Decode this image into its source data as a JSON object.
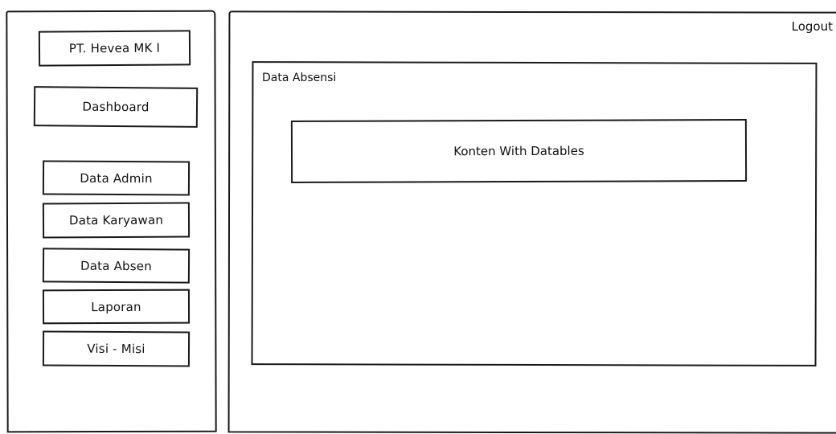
{
  "sidebar": {
    "brand": "PT. Hevea MK I",
    "dashboard": "Dashboard",
    "items": [
      {
        "label": "Data Admin"
      },
      {
        "label": "Data Karyawan"
      },
      {
        "label": "Data Absen"
      },
      {
        "label": "Laporan"
      },
      {
        "label": "Visi - Misi"
      }
    ]
  },
  "header": {
    "logout": "Logout"
  },
  "main": {
    "title": "Data Absensi",
    "content_placeholder": "Konten With Datables"
  }
}
